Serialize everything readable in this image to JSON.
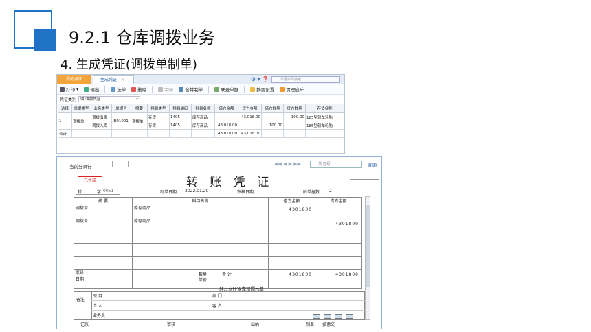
{
  "slide": {
    "title": "9.2.1  仓库调拨业务",
    "subtitle": "4. 生成凭证(调拨单制单)"
  },
  "top": {
    "tabs": {
      "home": "我的桌面",
      "active": "生成凭证"
    },
    "search_placeholder": "单据条码搜索",
    "toolbar": [
      "打印",
      "输出",
      "选单",
      "删除",
      "制单",
      "合并制单",
      "联查单据",
      "摘要设置",
      "清理应斥"
    ],
    "voucher_type_label": "凭证类别",
    "voucher_type_value": "收 收款凭证",
    "columns": [
      "选择",
      "单据类型",
      "业务类型",
      "单据号",
      "摘要",
      "科目类型",
      "科目编码",
      "科目名称",
      "借方金额",
      "贷方金额",
      "借方数量",
      "贷方数量",
      "存货名称"
    ],
    "rows": [
      {
        "sel": "1",
        "dtype": "调拨单",
        "btype1": "调拨出库",
        "btype2": "调拨入库",
        "no": "JB01001",
        "sum": "调拨单",
        "lines": [
          {
            "ktype": "存货",
            "code": "1405",
            "name": "库存商品",
            "debit": "",
            "credit": "43,018.00",
            "dq": "",
            "cq": "100.00",
            "inv": "185型轿车轮胎"
          },
          {
            "ktype": "存货",
            "code": "1405",
            "name": "库存商品",
            "debit": "43,018.00",
            "credit": "",
            "dq": "100.00",
            "cq": "",
            "inv": "185型轿车轮胎"
          }
        ]
      }
    ],
    "total": {
      "label": "合计",
      "debit": "43,018.00",
      "credit": "43,018.00"
    }
  },
  "voucher": {
    "current_label": "当前分录行",
    "search_placeholder": "凭证号",
    "query": "查询",
    "title": "转 账 凭 证",
    "stamp": "已生成",
    "word": "转",
    "no_label": "字",
    "no": "0051",
    "date_label": "制单日期：",
    "date": "2022.01.20",
    "audit_label": "审核日期：",
    "attach_label": "附单据数：",
    "attach": "2",
    "col_summary": "摘 要",
    "col_account": "科目名称",
    "col_debit": "借方金额",
    "col_credit": "贷方金额",
    "entries": [
      {
        "summary": "调拨单",
        "account": "库存商品",
        "debit": "4301800",
        "credit": ""
      },
      {
        "summary": "调拨单",
        "account": "库存商品",
        "debit": "",
        "credit": "4301800"
      }
    ],
    "ticket_label": "票号",
    "date2_label": "日期",
    "qty_label": "数量",
    "price_label": "单价",
    "total_label": "合 计",
    "total_debit": "4301800",
    "total_credit": "4301800",
    "amount_words": "肆万叁仟零壹拾捌元整",
    "remark_label": "备注",
    "project": "项  目",
    "dept": "部  门",
    "person": "个  人",
    "customer": "客  户",
    "salesman": "业务员",
    "footer": {
      "bookkeeper": "记账",
      "auditor": "审核",
      "cashier": "出纳",
      "maker_label": "制单",
      "maker": "张德文"
    }
  }
}
